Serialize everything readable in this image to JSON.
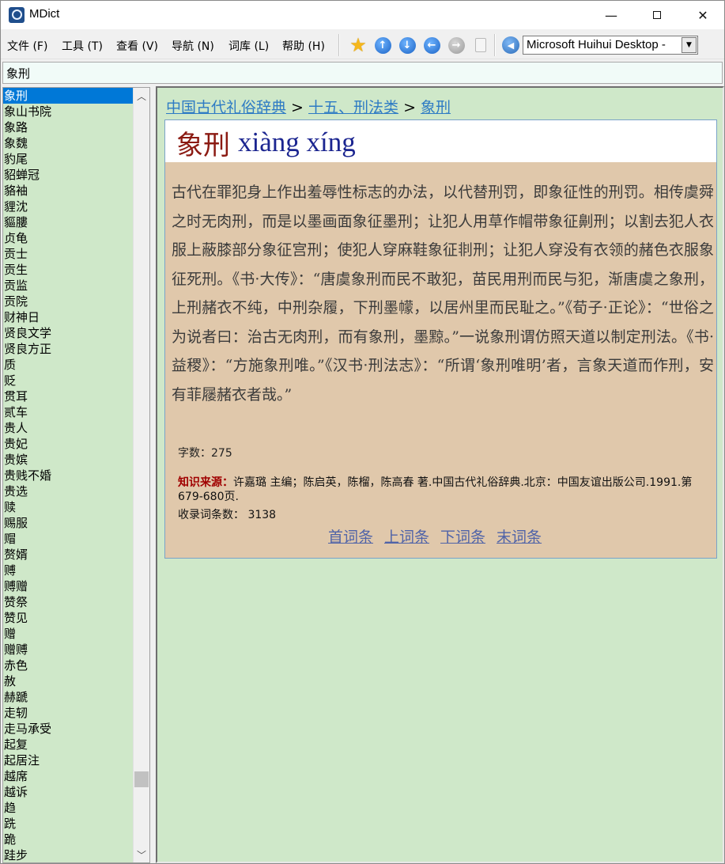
{
  "window": {
    "title": "MDict",
    "minimize": "—",
    "close": "✕"
  },
  "menu": [
    "文件 (F)",
    "工具 (T)",
    "查看 (V)",
    "导航 (N)",
    "词库 (L)",
    "帮助 (H)"
  ],
  "toolbar": {
    "icons": [
      "favorite-star-icon",
      "up-arrow-icon",
      "down-arrow-icon",
      "back-arrow-icon",
      "forward-arrow-icon",
      "clipboard-icon",
      "speaker-icon"
    ],
    "up": "↑",
    "down": "↓",
    "back": "←",
    "forward": "→",
    "speak": "◀",
    "dictionary_selected": "Microsoft Huihui Desktop -",
    "dropdown_arrow": "▼"
  },
  "search": {
    "value": "象刑"
  },
  "wordlist": {
    "items": [
      "象刑",
      "象山书院",
      "象路",
      "象魏",
      "豹尾",
      "貂蝉冠",
      "貉袖",
      "貍沈",
      "貙膢",
      "贞龟",
      "贡士",
      "贡生",
      "贡监",
      "贡院",
      "财神日",
      "贤良文学",
      "贤良方正",
      "质",
      "贬",
      "贯耳",
      "贰车",
      "贵人",
      "贵妃",
      "贵嫔",
      "贵贱不婚",
      "贵选",
      "赎",
      "赐服",
      "赗",
      "赘婿",
      "赙",
      "赙赠",
      "赞祭",
      "赞见",
      "赠",
      "赠赙",
      "赤色",
      "赦",
      "赫蹏",
      "走轫",
      "走马承受",
      "起复",
      "起居注",
      "越席",
      "越诉",
      "趋",
      "跣",
      "跪",
      "跬步"
    ],
    "selected": "象刑",
    "scroll_up": "︿",
    "scroll_down": "﹀"
  },
  "content": {
    "breadcrumb": {
      "root": "中国古代礼俗辞典",
      "sep1": " > ",
      "section": "十五、刑法类",
      "sep2": " > ",
      "current": "象刑"
    },
    "headword": "象刑",
    "pinyin": "xiàng xíng",
    "definition": "古代在罪犯身上作出羞辱性标志的办法，以代替刑罚，即象征性的刑罚。相传虞舜之时无肉刑，而是以墨画面象征墨刑；让犯人用草作帽带象征劓刑；以割去犯人衣服上蔽膝部分象征宫刑；使犯人穿麻鞋象征剕刑；让犯人穿没有衣领的赭色衣服象征死刑。《书·大传》：“唐虞象刑而民不敢犯，苗民用刑而民与犯，渐唐虞之象刑，上刑赭衣不纯，中刑杂履，下刑墨幪，以居州里而民耻之。”《荀子·正论》：“世俗之为说者曰：治古无肉刑，而有象刑，墨黥。”一说象刑谓仿照天道以制定刑法。《书·益稷》：“方施象刑唯。”《汉书·刑法志》：“所谓‘象刑唯明’者，言象天道而作刑，安有菲屦赭衣者哉。”",
    "word_count": "字数：275",
    "source_label": "知识来源：",
    "source_text": "许嘉璐 主编；陈启英，陈榴，陈高春 著.中国古代礼俗辞典.北京：中国友谊出版公司.1991.第679-680页.",
    "entry_count": "收录词条数： 3138",
    "nav": [
      "首词条",
      "上词条",
      "下词条",
      "末词条"
    ]
  },
  "colors": {
    "list_bg": "#cfe8c9",
    "selected_bg": "#0078d7",
    "entry_bg": "#e0c8ab",
    "headword": "#8b1a12",
    "pinyin": "#1b2590",
    "link": "#2e7bc4"
  }
}
